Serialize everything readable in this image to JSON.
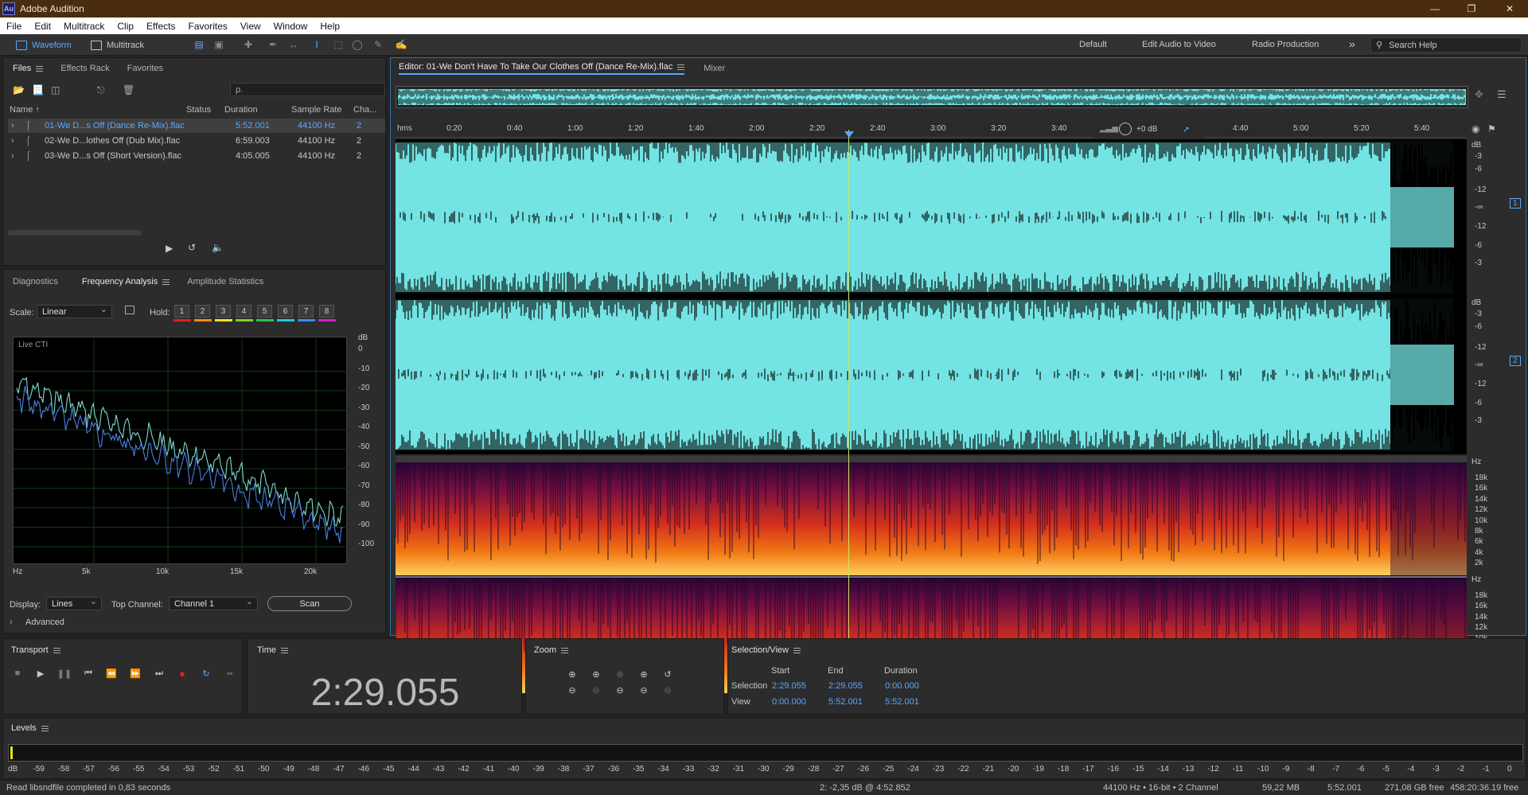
{
  "app": {
    "logo": "Au",
    "title": "Adobe Audition"
  },
  "menu": [
    "File",
    "Edit",
    "Multitrack",
    "Clip",
    "Effects",
    "Favorites",
    "View",
    "Window",
    "Help"
  ],
  "toolbar": {
    "waveform_label": "Waveform",
    "multitrack_label": "Multitrack",
    "workspaces": [
      "Default",
      "Edit Audio to Video",
      "Radio Production"
    ],
    "more": "»",
    "search_placeholder": "Search Help"
  },
  "files_panel": {
    "tabs": [
      "Files",
      "Effects Rack",
      "Favorites"
    ],
    "search_value": "ρ.",
    "columns": [
      "Name ↑",
      "Status",
      "Duration",
      "Sample Rate",
      "Cha..."
    ],
    "rows": [
      {
        "name": "01-We D...s Off (Dance Re-Mix).flac",
        "status": "",
        "duration": "5:52.001",
        "rate": "44100 Hz",
        "ch": "2",
        "selected": true
      },
      {
        "name": "02-We D...lothes Off (Dub Mix).flac",
        "status": "",
        "duration": "6:59.003",
        "rate": "44100 Hz",
        "ch": "2",
        "selected": false
      },
      {
        "name": "03-We D...s Off (Short Version).flac",
        "status": "",
        "duration": "4:05.005",
        "rate": "44100 Hz",
        "ch": "2",
        "selected": false
      }
    ]
  },
  "analysis_panel": {
    "tabs": [
      "Diagnostics",
      "Frequency Analysis",
      "Amplitude Statistics"
    ],
    "scale_label": "Scale:",
    "scale_value": "Linear",
    "hold_label": "Hold:",
    "hold_buttons": [
      "1",
      "2",
      "3",
      "4",
      "5",
      "6",
      "7",
      "8"
    ],
    "hold_colors": [
      "#e02020",
      "#f08a1a",
      "#f0e020",
      "#7ad22a",
      "#30c050",
      "#20c8e0",
      "#3a8cf0",
      "#d020d0"
    ],
    "graph_label": "Live CTI",
    "db_unit": "dB",
    "db_ticks": [
      "0",
      "-10",
      "-20",
      "-30",
      "-40",
      "-50",
      "-60",
      "-70",
      "-80",
      "-90",
      "-100"
    ],
    "freq_ticks": [
      "Hz",
      "5k",
      "10k",
      "15k",
      "20k"
    ],
    "display_label": "Display:",
    "display_value": "Lines",
    "top_channel_label": "Top Channel:",
    "top_channel_value": "Channel 1",
    "scan_label": "Scan",
    "advanced_label": "Advanced"
  },
  "editor": {
    "tab_title": "Editor: 01-We Don't Have To Take Our Clothes Off (Dance Re-Mix).flac",
    "mixer_tab": "Mixer",
    "timeline_unit": "hms",
    "timeline_ticks": [
      "0:20",
      "0:40",
      "1:00",
      "1:20",
      "1:40",
      "2:00",
      "2:20",
      "2:40",
      "3:00",
      "3:20",
      "3:40",
      "4:40",
      "5:00",
      "5:20",
      "5:40"
    ],
    "gain_value": "+0 dB",
    "amp_unit": "dB",
    "amp_ticks": [
      "-3",
      "-6",
      "-12",
      "-∞",
      "-12",
      "-6",
      "-3"
    ],
    "channel_badges": [
      "1",
      "2"
    ],
    "hz_unit": "Hz",
    "spec_ticks": [
      "18k",
      "16k",
      "14k",
      "12k",
      "10k",
      "8k",
      "6k",
      "4k",
      "2k"
    ],
    "waveform_color": "#74e3e3",
    "playhead_color": "#c8e860"
  },
  "transport": {
    "title": "Transport"
  },
  "time_panel": {
    "title": "Time",
    "value": "2:29.055"
  },
  "zoom_panel": {
    "title": "Zoom"
  },
  "selection_panel": {
    "title": "Selection/View",
    "col_start": "Start",
    "col_end": "End",
    "col_duration": "Duration",
    "row_selection": "Selection",
    "row_view": "View",
    "selection": {
      "start": "2:29.055",
      "end": "2:29.055",
      "duration": "0:00.000"
    },
    "view": {
      "start": "0:00.000",
      "end": "5:52.001",
      "duration": "5:52.001"
    }
  },
  "levels": {
    "title": "Levels",
    "ticks": [
      "dB",
      "-59",
      "-58",
      "-57",
      "-56",
      "-55",
      "-54",
      "-53",
      "-52",
      "-51",
      "-50",
      "-49",
      "-48",
      "-47",
      "-46",
      "-45",
      "-44",
      "-43",
      "-42",
      "-41",
      "-40",
      "-39",
      "-38",
      "-37",
      "-36",
      "-35",
      "-34",
      "-33",
      "-32",
      "-31",
      "-30",
      "-29",
      "-28",
      "-27",
      "-26",
      "-25",
      "-24",
      "-23",
      "-22",
      "-21",
      "-20",
      "-19",
      "-18",
      "-17",
      "-16",
      "-15",
      "-14",
      "-13",
      "-12",
      "-11",
      "-10",
      "-9",
      "-8",
      "-7",
      "-6",
      "-5",
      "-4",
      "-3",
      "-2",
      "-1",
      "0"
    ]
  },
  "status_bar": {
    "message": "Read libsndfile completed in 0,83 seconds",
    "cursor_info": "2: -2,35 dB @ 4:52.852",
    "format": "44100 Hz • 16-bit • 2 Channel",
    "size": "59,22 MB",
    "duration": "5:52.001",
    "free_space": "271,08 GB free",
    "free_time": "458:20:36.19 free"
  }
}
